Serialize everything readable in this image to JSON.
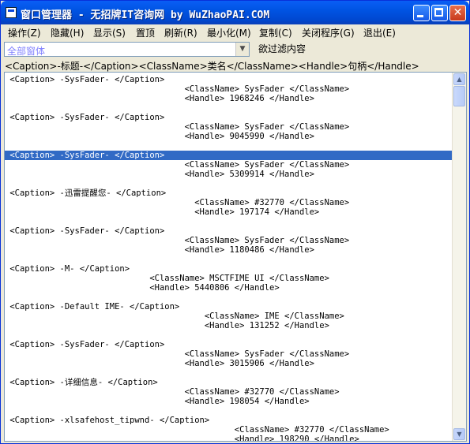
{
  "window": {
    "title": "窗口管理器 - 无招牌IT咨询网 by WuZhaoPAI.COM"
  },
  "menu": [
    "操作(Z)",
    "隐藏(H)",
    "显示(S)",
    "置顶",
    "刷新(R)",
    "最小化(M)",
    "复制(C)",
    "关闭程序(G)",
    "退出(E)"
  ],
  "filter": {
    "combo_value": "全部窗体",
    "label": "欲过滤内容"
  },
  "list_header": "<Caption>-标题-</Caption><ClassName>类名</ClassName><Handle>句柄</Handle>",
  "list_lines": [
    " <Caption> -SysFader- </Caption>",
    "                                    <ClassName> SysFader </ClassName>",
    "                                    <Handle> 1968246 </Handle>",
    " <Caption> -SysFader- </Caption>",
    "                                    <ClassName> SysFader </ClassName>",
    "                                    <Handle> 9045990 </Handle>",
    " <Caption> -SysFader- </Caption>",
    "                                    <ClassName> SysFader </ClassName>",
    "                                    <Handle> 5309914 </Handle>",
    " <Caption> -迅雷提醒您- </Caption>",
    "                                      <ClassName> #32770 </ClassName>",
    "                                      <Handle> 197174 </Handle>",
    " <Caption> -SysFader- </Caption>",
    "                                    <ClassName> SysFader </ClassName>",
    "                                    <Handle> 1180486 </Handle>",
    " <Caption> -M- </Caption>",
    "                             <ClassName> MSCTFIME UI </ClassName>",
    "                             <Handle> 5440806 </Handle>",
    " <Caption> -Default IME- </Caption>",
    "                                        <ClassName> IME </ClassName>",
    "                                        <Handle> 131252 </Handle>",
    " <Caption> -SysFader- </Caption>",
    "                                    <ClassName> SysFader </ClassName>",
    "                                    <Handle> 3015906 </Handle>",
    " <Caption> -详细信息- </Caption>",
    "                                    <ClassName> #32770 </ClassName>",
    "                                    <Handle> 198054 </Handle>",
    " <Caption> -xlsafehost_tipwnd- </Caption>",
    "                                              <ClassName> #32770 </ClassName>",
    "                                              <Handle> 198290 </Handle>"
  ],
  "selected_line": 6
}
